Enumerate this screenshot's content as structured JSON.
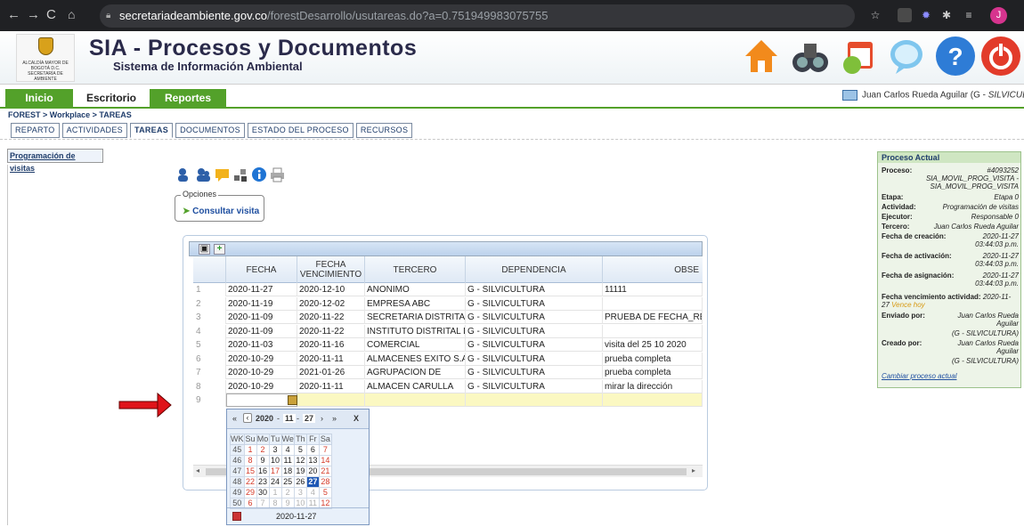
{
  "browser": {
    "domain": "secretariadeambiente.gov.co",
    "path": "/forestDesarrollo/usutareas.do?a=0.751949983075755",
    "profile_initial": "J"
  },
  "banner": {
    "crest_text": "ALCALDÍA MAYOR DE BOGOTÁ D.C. SECRETARÍA DE AMBIENTE",
    "title": "SIA - Procesos y Documentos",
    "subtitle": "Sistema de Información Ambiental",
    "icons": [
      "home-icon",
      "binoculars-icon",
      "calendar-icon",
      "chat-icon",
      "help-icon",
      "power-icon"
    ]
  },
  "mainnav": {
    "inicio": "Inicio",
    "escritorio": "Escritorio",
    "reportes": "Reportes"
  },
  "user": "Juan Carlos Rueda Aguilar (G - ",
  "user_dep": "SILVICULTURA",
  "user_close": ")",
  "breadcrumb": "FOREST > Workplace > TAREAS",
  "tabs": [
    "REPARTO",
    "ACTIVIDADES",
    "TAREAS",
    "DOCUMENTOS",
    "ESTADO DEL PROCESO",
    "RECURSOS"
  ],
  "left_button": "Programación de visitas",
  "opciones": {
    "legend": "Opciones",
    "link": "Consultar visita"
  },
  "grid": {
    "headers": [
      "FECHA",
      "FECHA VENCIMIENTO",
      "TERCERO",
      "DEPENDENCIA",
      "OBSE"
    ],
    "rows": [
      [
        "1",
        "2020-11-27",
        "2020-12-10",
        "ANONIMO",
        "G - SILVICULTURA",
        "11111"
      ],
      [
        "2",
        "2020-11-19",
        "2020-12-02",
        "EMPRESA ABC",
        "G - SILVICULTURA",
        ""
      ],
      [
        "3",
        "2020-11-09",
        "2020-11-22",
        "SECRETARIA DISTRITAL",
        "G - SILVICULTURA",
        "PRUEBA DE FECHA_REC"
      ],
      [
        "4",
        "2020-11-09",
        "2020-11-22",
        "INSTITUTO DISTRITAL DE",
        "G - SILVICULTURA",
        ""
      ],
      [
        "5",
        "2020-11-03",
        "2020-11-16",
        "COMERCIAL",
        "G - SILVICULTURA",
        "visita del 25 10 2020"
      ],
      [
        "6",
        "2020-10-29",
        "2020-11-11",
        "ALMACENES EXITO S.A",
        "G - SILVICULTURA",
        "prueba completa"
      ],
      [
        "7",
        "2020-10-29",
        "2021-01-26",
        "AGRUPACION DE",
        "G - SILVICULTURA",
        "prueba completa"
      ],
      [
        "8",
        "2020-10-29",
        "2020-11-11",
        "ALMACEN CARULLA",
        "G - SILVICULTURA",
        "mirar la dirección"
      ],
      [
        "9",
        "",
        "",
        "",
        "",
        ""
      ]
    ]
  },
  "calendar": {
    "year": "2020",
    "month": "11",
    "day": "27",
    "close": "X",
    "days": [
      "WK",
      "Su",
      "Mo",
      "Tu",
      "We",
      "Th",
      "Fr",
      "Sa"
    ],
    "weeks": [
      [
        "45",
        "1",
        "2",
        "3",
        "4",
        "5",
        "6",
        "7"
      ],
      [
        "46",
        "8",
        "9",
        "10",
        "11",
        "12",
        "13",
        "14"
      ],
      [
        "47",
        "15",
        "16",
        "17",
        "18",
        "19",
        "20",
        "21"
      ],
      [
        "48",
        "22",
        "23",
        "24",
        "25",
        "26",
        "27",
        "28"
      ],
      [
        "49",
        "29",
        "30",
        "1",
        "2",
        "3",
        "4",
        "5"
      ],
      [
        "50",
        "6",
        "7",
        "8",
        "9",
        "10",
        "11",
        "12"
      ]
    ],
    "footer": "2020-11-27"
  },
  "panel": {
    "title": "Proceso Actual",
    "proceso_label": "Proceso:",
    "proceso_val": "#4093252",
    "proceso_name": "SIA_MOVIL_PROG_VISITA - SIA_MOVIL_PROG_VISITA",
    "etapa_label": "Etapa:",
    "etapa_val": "Etapa 0",
    "actividad_label": "Actividad:",
    "actividad_val": "Programación de visitas",
    "ejecutor_label": "Ejecutor:",
    "ejecutor_val": "Responsable 0",
    "tercero_label": "Tercero:",
    "tercero_val": "Juan Carlos Rueda Aguilar",
    "creacion_label": "Fecha de creación:",
    "creacion_val": "2020-11-27 03:44:03 p.m.",
    "activacion_label": "Fecha de activación:",
    "activacion_val": "2020-11-27 03:44:03 p.m.",
    "asignacion_label": "Fecha de asignación:",
    "asignacion_val": "2020-11-27 03:44:03 p.m.",
    "venc_label": "Fecha vencimiento actividad:",
    "venc_val": "2020-11-27",
    "venc_warn": "Vence hoy",
    "enviado_label": "Enviado por:",
    "enviado_val": "Juan Carlos Rueda Aguilar",
    "enviado_dep": "(G - SILVICULTURA)",
    "creado_label": "Creado por:",
    "creado_val": "Juan Carlos Rueda Aguilar",
    "creado_dep": "(G - SILVICULTURA)",
    "cambiar": "Cambiar proceso actual"
  }
}
